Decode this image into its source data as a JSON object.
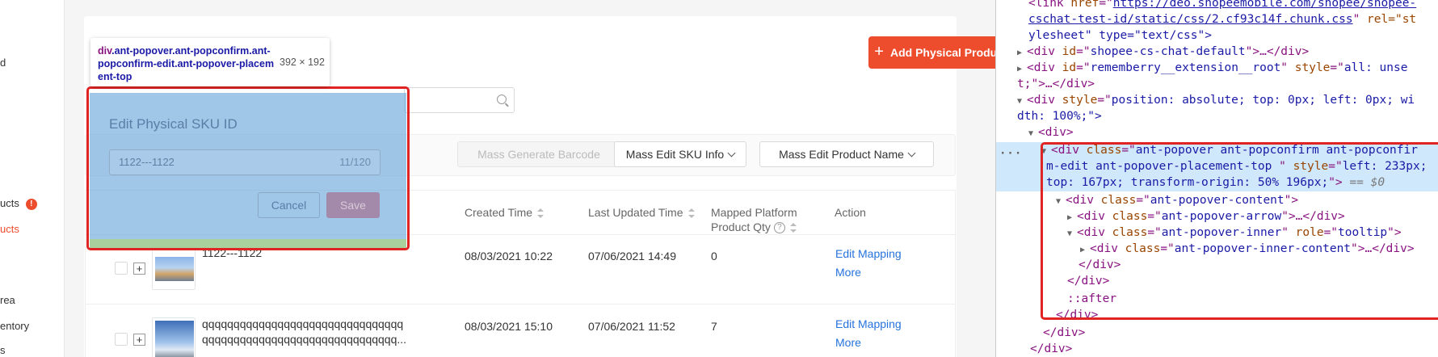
{
  "leftnav": {
    "items": [
      {
        "label": "d",
        "active": false
      },
      {
        "label": "ucts",
        "active": false,
        "badge": "!"
      },
      {
        "label": "ucts",
        "active": true
      },
      {
        "label": "rea",
        "active": false
      },
      {
        "label": "entory",
        "active": false
      },
      {
        "label": "s",
        "active": false
      }
    ]
  },
  "header": {
    "add_button": "Add Physical Product",
    "search_placeholder": ""
  },
  "toolbar": {
    "mass_generate_barcode": "Mass Generate Barcode",
    "mass_edit_sku_info": "Mass Edit SKU Info",
    "mass_edit_product_name": "Mass Edit Product Name"
  },
  "table": {
    "columns": {
      "created_time": "Created Time",
      "last_updated_time": "Last Updated Time",
      "mapped_qty_line1": "Mapped Platform",
      "mapped_qty_line2": "Product Qty",
      "action": "Action"
    },
    "rows": [
      {
        "sku": "1122---1122",
        "created": "08/03/2021 10:22",
        "updated": "07/06/2021 14:49",
        "mapped_qty": "0",
        "action_edit": "Edit Mapping",
        "action_more": "More"
      },
      {
        "name_line1": "qqqqqqqqqqqqqqqqqqqqqqqqqqqqqqqq",
        "name_line2": "qqqqqqqqqqqqqqqqqqqqqqqqqqqqqqq...",
        "created": "08/03/2021 15:10",
        "updated": "07/06/2021 11:52",
        "mapped_qty": "7",
        "action_edit": "Edit Mapping",
        "action_more": "More"
      }
    ]
  },
  "popover": {
    "title": "Edit Physical SKU ID",
    "input_value": "1122---1122",
    "input_count": "11/120",
    "cancel": "Cancel",
    "save": "Save"
  },
  "inspector_tooltip": {
    "tag": "div",
    "classes": ".ant-popover.ant-popconfirm.ant-popconfirm-edit.ant-popover-placement-top",
    "size": "392 × 192"
  },
  "devtools": {
    "dots": "···",
    "l1_href": "https://deo.shopeemobile.com/shopee/shopee-",
    "l2_href": "cschat-test-id/static/css/2.cf93c14f.chunk.css",
    "l2_rest": " rel=\"st",
    "l3": "ylesheet\" type=\"text/css\">",
    "l4_id": "shopee-cs-chat-default",
    "l5_id": "rememberry__extension__root",
    "l5_style": "all: unse",
    "l6": "t;\">…</div>",
    "l7_style": "position: absolute; top: 0px; left: 0px; wi",
    "l8": "dth: 100%;\">",
    "l9": "<div>",
    "l10_class": "ant-popover ant-popconfirm ant-popconfir",
    "l11": "m-edit ant-popover-placement-top ",
    "l11_style": "left: 233px;",
    "l12": "top: 167px; transform-origin: 50% 196px;",
    "l12_eq": " == $0",
    "l13_class": "ant-popover-content",
    "l14_class": "ant-popover-arrow",
    "l15_class": "ant-popover-inner",
    "l15_role": "tooltip",
    "l16_class": "ant-popover-inner-content",
    "l17": "</div>",
    "l18": "</div>",
    "l19": "::after",
    "l20": "</div>",
    "l21": "</div>",
    "l22": "</div>"
  },
  "colors": {
    "accent": "#ee4d2d",
    "link": "#2673dd",
    "highlight_border": "#e02424"
  }
}
